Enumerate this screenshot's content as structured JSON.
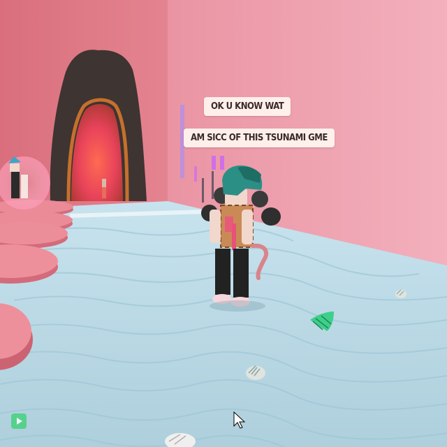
{
  "game": {
    "chat_bubbles": [
      {
        "text": "OK U KNOW WAT"
      },
      {
        "text": "AM SICC OF THIS TSUNAMI GME"
      }
    ],
    "recorder_watermark": "",
    "colors": {
      "wall": "#e99aa6",
      "floor": "#b9dbe6",
      "platforms": "#e07c88",
      "portal_glow": "#ff5a3c",
      "rock": "#3a3230"
    },
    "icons": [
      "cursor-icon",
      "record-icon",
      "seashell-icon",
      "tree-shell-icon"
    ]
  }
}
